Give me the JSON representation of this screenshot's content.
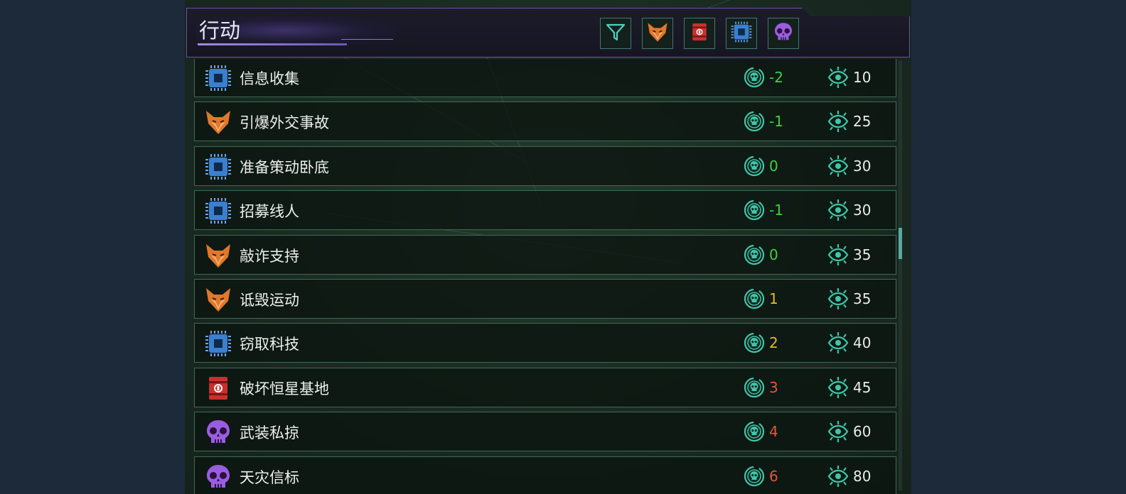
{
  "header": {
    "title": "行动"
  },
  "filters": [
    {
      "name": "filter",
      "icon": "funnel-icon"
    },
    {
      "name": "fox",
      "icon": "fox-icon"
    },
    {
      "name": "sabotage",
      "icon": "barrel-icon"
    },
    {
      "name": "tech",
      "icon": "chip-icon"
    },
    {
      "name": "skull",
      "icon": "skull-icon"
    }
  ],
  "colors": {
    "risk_low": "#3fd13f",
    "risk_mid": "#e6b830",
    "risk_high": "#e5553a",
    "chip": "#3a7fd0",
    "fox": "#e0782c",
    "barrel": "#c9302c",
    "skull": "#9b5de0"
  },
  "actions": [
    {
      "icon": "chip-icon",
      "name": "信息收集",
      "risk": "-2",
      "risk_level": "low",
      "cost": "10"
    },
    {
      "icon": "fox-icon",
      "name": "引爆外交事故",
      "risk": "-1",
      "risk_level": "low",
      "cost": "25"
    },
    {
      "icon": "chip-icon",
      "name": "准备策动卧底",
      "risk": "0",
      "risk_level": "low",
      "cost": "30"
    },
    {
      "icon": "chip-icon",
      "name": "招募线人",
      "risk": "-1",
      "risk_level": "low",
      "cost": "30"
    },
    {
      "icon": "fox-icon",
      "name": "敲诈支持",
      "risk": "0",
      "risk_level": "low",
      "cost": "35"
    },
    {
      "icon": "fox-icon",
      "name": "诋毁运动",
      "risk": "1",
      "risk_level": "mid",
      "cost": "35"
    },
    {
      "icon": "chip-icon",
      "name": "窃取科技",
      "risk": "2",
      "risk_level": "mid",
      "cost": "40"
    },
    {
      "icon": "barrel-icon",
      "name": "破坏恒星基地",
      "risk": "3",
      "risk_level": "high",
      "cost": "45"
    },
    {
      "icon": "skull-icon",
      "name": "武装私掠",
      "risk": "4",
      "risk_level": "high",
      "cost": "60"
    },
    {
      "icon": "skull-icon",
      "name": "天灾信标",
      "risk": "6",
      "risk_level": "high",
      "cost": "80"
    }
  ]
}
